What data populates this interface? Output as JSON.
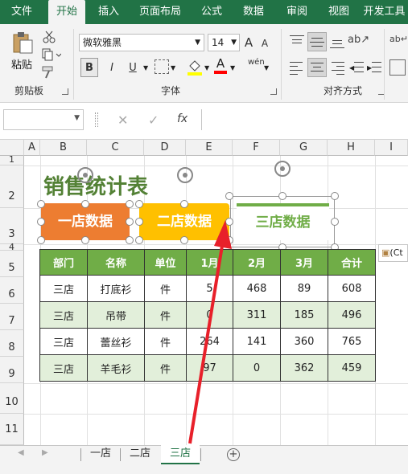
{
  "ribbon_tabs": [
    "文件",
    "开始",
    "插入",
    "页面布局",
    "公式",
    "数据",
    "审阅",
    "视图",
    "开发工具"
  ],
  "active_tab": "开始",
  "clipboard": {
    "paste_label": "粘贴",
    "group_label": "剪贴板"
  },
  "font": {
    "name": "微软雅黑",
    "size": "14",
    "group_label": "字体",
    "bold": "B",
    "italic": "I",
    "underline": "U",
    "grow": "A",
    "shrink": "A",
    "phonetic": "wén"
  },
  "alignment": {
    "group_label": "对齐方式"
  },
  "formula_bar": {
    "name_box": "",
    "fx": "fx",
    "content": ""
  },
  "columns": [
    "A",
    "B",
    "C",
    "D",
    "E",
    "F",
    "G",
    "H",
    "I"
  ],
  "rows": [
    "1",
    "2",
    "3",
    "4",
    "5",
    "6",
    "7",
    "8",
    "9",
    "10",
    "11"
  ],
  "sheet_title": "销售统计表",
  "shapes": [
    {
      "label": "一店数据",
      "fill": "#ed7d31"
    },
    {
      "label": "二店数据",
      "fill": "#ffc000"
    },
    {
      "label": "三店数据",
      "fill": "#ffffff",
      "text_color": "#70ad47"
    }
  ],
  "table": {
    "headers": [
      "部门",
      "名称",
      "单位",
      "1月",
      "2月",
      "3月",
      "合计"
    ],
    "rows": [
      [
        "三店",
        "打底衫",
        "件",
        "5",
        "468",
        "89",
        "608"
      ],
      [
        "三店",
        "吊带",
        "件",
        "0",
        "311",
        "185",
        "496"
      ],
      [
        "三店",
        "蕾丝衫",
        "件",
        "264",
        "141",
        "360",
        "765"
      ],
      [
        "三店",
        "羊毛衫",
        "件",
        "97",
        "0",
        "362",
        "459"
      ]
    ]
  },
  "paste_options_tag": "(Ct",
  "sheet_tabs": [
    "一店",
    "二店",
    "三店"
  ],
  "active_sheet": "三店",
  "colors": {
    "excel_green": "#217346",
    "header_green": "#70ad47",
    "band_green": "#e2efda",
    "title_green": "#538135",
    "arrow_red": "#e8202a"
  }
}
